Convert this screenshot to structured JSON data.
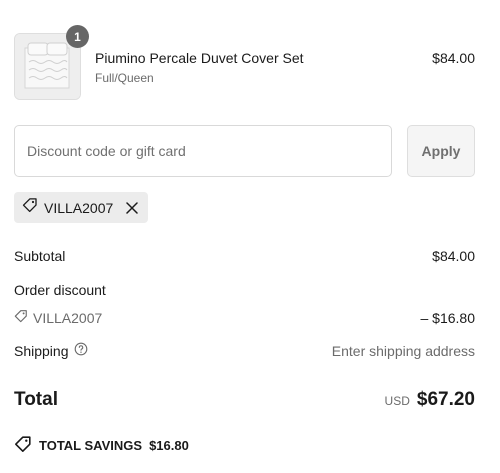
{
  "line_item": {
    "quantity": "1",
    "name": "Piumino Percale Duvet Cover Set",
    "variant": "Full/Queen",
    "price": "$84.00",
    "thumbnail_icon": "duvet-product-image"
  },
  "discount": {
    "placeholder": "Discount code or gift card",
    "value": "",
    "apply_label": "Apply"
  },
  "applied_code": {
    "label": "VILLA2007",
    "icon": "tag-icon",
    "remove_icon": "close-icon"
  },
  "summary": {
    "subtotal_label": "Subtotal",
    "subtotal_value": "$84.00",
    "order_discount_label": "Order discount",
    "discount_code": "VILLA2007",
    "discount_value": "– $16.80",
    "shipping_label": "Shipping",
    "shipping_value": "Enter shipping address",
    "total_label": "Total",
    "total_currency": "USD",
    "total_value": "$67.20"
  },
  "savings": {
    "label": "TOTAL SAVINGS",
    "value": "$16.80"
  },
  "colors": {
    "badge": "#666666",
    "chip_bg": "#ececec",
    "muted_text": "#6b6b6b",
    "border": "#d9d9d9"
  }
}
